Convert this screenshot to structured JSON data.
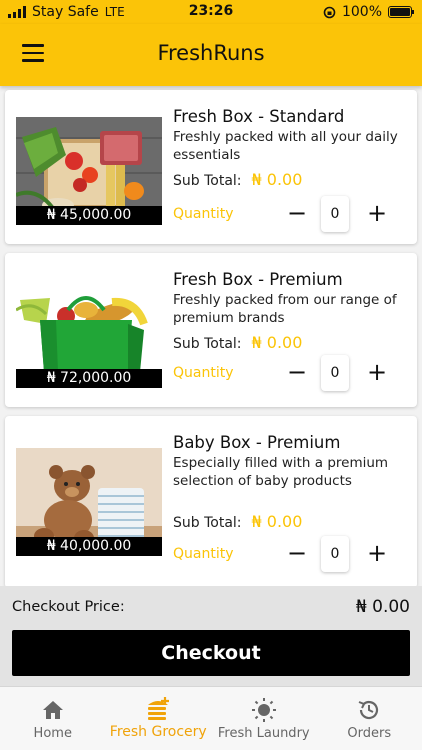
{
  "status": {
    "carrier": "Stay Safe",
    "network": "LTE",
    "time": "23:26",
    "battery": "100%"
  },
  "app": {
    "title": "FreshRuns",
    "accent": "#fbc408"
  },
  "labels": {
    "sub_total": "Sub Total:",
    "quantity": "Quantity",
    "minus": "−",
    "plus": "+"
  },
  "products": [
    {
      "title": "Fresh Box - Standard",
      "description": "Freshly packed with all your daily essentials",
      "price": "₦ 45,000.00",
      "sub_total": "₦ 0.00",
      "quantity": "0"
    },
    {
      "title": "Fresh Box - Premium",
      "description": "Freshly packed from our range of premium brands",
      "price": "₦ 72,000.00",
      "sub_total": "₦ 0.00",
      "quantity": "0"
    },
    {
      "title": "Baby Box - Premium",
      "description": "Especially filled with a premium selection of baby products",
      "price": "₦ 40,000.00",
      "sub_total": "₦ 0.00",
      "quantity": "0"
    }
  ],
  "checkout": {
    "label": "Checkout Price:",
    "value": "₦ 0.00",
    "button": "Checkout"
  },
  "tabs": [
    {
      "label": "Home",
      "icon": "home-icon",
      "active": false
    },
    {
      "label": "Fresh Grocery",
      "icon": "grocery-icon",
      "active": true
    },
    {
      "label": "Fresh Laundry",
      "icon": "sun-icon",
      "active": false
    },
    {
      "label": "Orders",
      "icon": "history-icon",
      "active": false
    }
  ]
}
